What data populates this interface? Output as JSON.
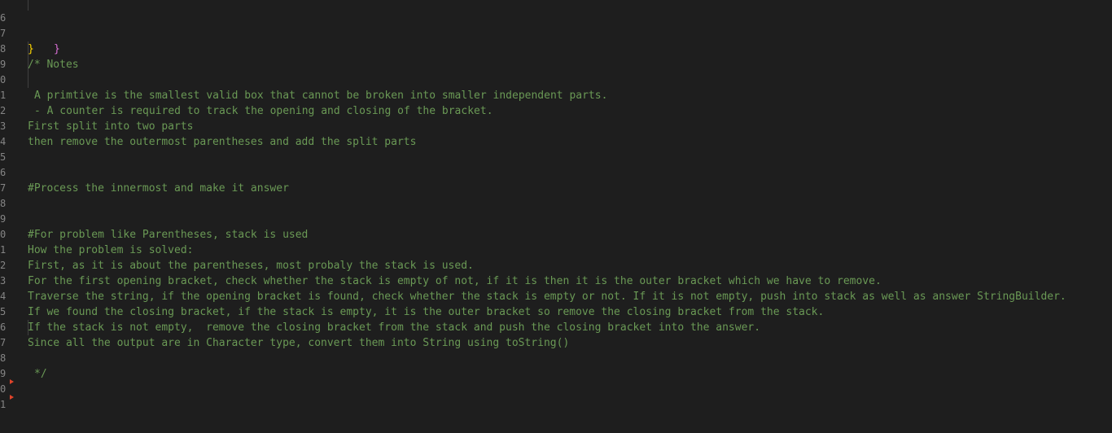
{
  "editor": {
    "lines": [
      {
        "num": "6",
        "text": "}"
      },
      {
        "num": "7",
        "text": "}"
      },
      {
        "num": "8",
        "text": "/* Notes"
      },
      {
        "num": "9",
        "text": "A primtive is the smallest valid box that cannot be broken into smaller independent parts."
      },
      {
        "num": "0",
        "text": "- A counter is required to track the opening and closing of the bracket."
      },
      {
        "num": "1",
        "text": ""
      },
      {
        "num": "2",
        "text": "First split into two parts"
      },
      {
        "num": "3",
        "text": "then remove the outermost parentheses and add the split parts"
      },
      {
        "num": "4",
        "text": ""
      },
      {
        "num": "5",
        "text": ""
      },
      {
        "num": "6",
        "text": "#Process the innermost and make it answer"
      },
      {
        "num": "7",
        "text": ""
      },
      {
        "num": "8",
        "text": ""
      },
      {
        "num": "9",
        "text": "#For problem like Parentheses, stack is used"
      },
      {
        "num": "0",
        "text": "How the problem is solved:"
      },
      {
        "num": "1",
        "text": "First, as it is about the parentheses, most probaly the stack is used."
      },
      {
        "num": "2",
        "text": "For the first opening bracket, check whether the stack is empty of not, if it is then it is the outer bracket which we have to remove."
      },
      {
        "num": "3",
        "text": "Traverse the string, if the opening bracket is found, check whether the stack is empty or not. If it is not empty, push into stack as well as answer StringBuilder."
      },
      {
        "num": "4",
        "text": "If we found the closing bracket, if the stack is empty, it is the outer bracket so remove the closing bracket from the stack."
      },
      {
        "num": "5",
        "text": "If the stack is not empty,  remove the closing bracket from the stack and push the closing bracket into the answer."
      },
      {
        "num": "6",
        "text": "Since all the output are in Character type, convert them into String using toString()"
      },
      {
        "num": "7",
        "text": "*/"
      },
      {
        "num": "8",
        "text": ""
      },
      {
        "num": "9",
        "text": ""
      },
      {
        "num": "0",
        "text": ""
      },
      {
        "num": "1",
        "text": ""
      }
    ]
  },
  "colors": {
    "background": "#1e1e1e",
    "comment": "#6a9955",
    "line_number": "#858585",
    "brace_yellow": "#ffd700",
    "brace_purple": "#da70d6",
    "error_marker": "#e0442a"
  }
}
